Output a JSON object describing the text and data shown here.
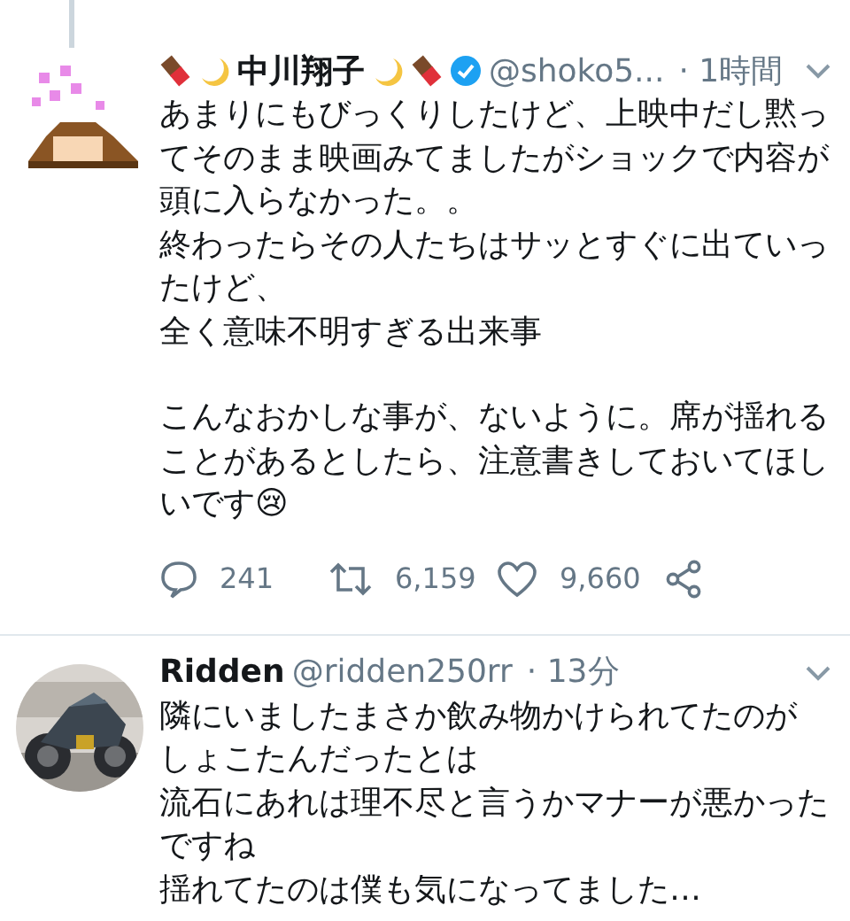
{
  "tweets": [
    {
      "name": "中川翔子",
      "verified": true,
      "handle": "@shoko5...",
      "time": "· 1時間",
      "blocks": [
        [
          "あまりにもびっくりしたけど、上映中だし黙ってそのまま映画みてましたがショックで内容が頭に入らなかった。。",
          "終わったらその人たちはサッとすぐに出ていったけど、",
          "全く意味不明すぎる出来事"
        ],
        [
          "こんなおかしな事が、ないように。席が揺れることがあるとしたら、注意書きしておいてほしいです😢"
        ]
      ],
      "actions": [
        {
          "kind": "reply",
          "count": "241"
        },
        {
          "kind": "retweet",
          "count": "6,159"
        },
        {
          "kind": "like",
          "count": "9,660"
        },
        {
          "kind": "share"
        }
      ]
    },
    {
      "name": "Ridden",
      "verified": false,
      "handle": "@ridden250rr",
      "time": "· 13分",
      "blocks": [
        [
          "隣にいましたまさか飲み物かけられてたのが",
          "しょこたんだったとは",
          "流石にあれは理不尽と言うかマナーが悪かったですね",
          "揺れてたのは僕も気になってました…"
        ]
      ]
    }
  ]
}
